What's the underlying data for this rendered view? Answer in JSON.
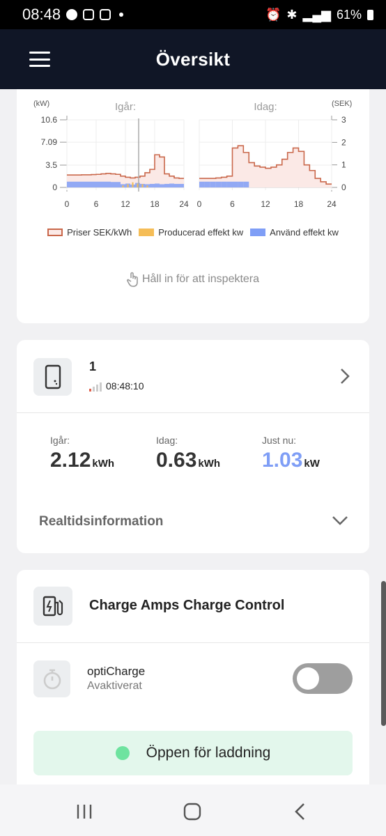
{
  "status_bar": {
    "time": "08:48",
    "battery": "61%"
  },
  "header": {
    "title": "Översikt"
  },
  "chart_data": {
    "type": "line",
    "panels": [
      {
        "title": "Igår:",
        "x_ticks": [
          "0",
          "6",
          "12",
          "18",
          "24"
        ],
        "prices": [
          0.55,
          0.55,
          0.55,
          0.56,
          0.56,
          0.57,
          0.58,
          0.6,
          0.62,
          0.6,
          0.58,
          0.5,
          0.45,
          0.42,
          0.45,
          0.5,
          0.65,
          0.8,
          1.45,
          1.35,
          0.6,
          0.5,
          0.42,
          0.4
        ],
        "used": [
          0.9,
          0.9,
          0.9,
          0.9,
          0.9,
          0.9,
          0.9,
          0.9,
          0.9,
          0.85,
          0.85,
          0.5,
          0.6,
          0.45,
          0.7,
          0.55,
          0.5,
          0.55,
          0.6,
          0.5,
          0.55,
          0.6,
          0.55,
          0.55
        ],
        "produced": [
          0,
          0,
          0,
          0,
          0,
          0,
          0,
          0,
          0,
          0,
          0,
          0.3,
          0.5,
          0.8,
          0.6,
          0.5,
          0.3,
          0,
          0,
          0,
          0,
          0,
          0,
          0
        ]
      },
      {
        "title": "Idag:",
        "x_ticks": [
          "0",
          "6",
          "12",
          "18",
          "24"
        ],
        "prices": [
          0.4,
          0.4,
          0.4,
          0.42,
          0.45,
          0.5,
          1.75,
          1.85,
          1.55,
          1.1,
          0.95,
          0.9,
          0.85,
          0.9,
          1.0,
          1.25,
          1.55,
          1.75,
          1.6,
          1.0,
          0.75,
          0.4,
          0.25,
          0.15
        ],
        "used": [
          0.9,
          0.9,
          0.9,
          0.9,
          0.9,
          0.9,
          0.9,
          0.9,
          0.9
        ]
      }
    ],
    "left_axis": {
      "label": "(kW)",
      "ticks": [
        "10.6",
        "7.09",
        "3.5",
        "0"
      ],
      "range": [
        0,
        10.6
      ]
    },
    "right_axis": {
      "label": "(SEK)",
      "ticks": [
        "3",
        "2",
        "1",
        "0"
      ],
      "range": [
        0,
        3
      ]
    },
    "legend": [
      {
        "label": "Priser SEK/kWh",
        "color": "#c9674a"
      },
      {
        "label": "Producerad effekt kw",
        "color": "#f5bd57"
      },
      {
        "label": "Använd effekt kw",
        "color": "#7f9ef6"
      }
    ]
  },
  "chart_hint": "Håll in för att inspektera",
  "device": {
    "name": "1",
    "last_seen": "08:48:10",
    "stats": [
      {
        "label": "Igår:",
        "value": "2.12",
        "unit": "kWh"
      },
      {
        "label": "Idag:",
        "value": "0.63",
        "unit": "kWh"
      },
      {
        "label": "Just nu:",
        "value": "1.03",
        "unit": "kW"
      }
    ],
    "realtime_label": "Realtidsinformation"
  },
  "charger": {
    "name": "Charge Amps Charge Control",
    "opti_name": "optiCharge",
    "opti_status": "Avaktiverat",
    "opti_enabled": false,
    "open_status": "Öppen för laddning"
  }
}
